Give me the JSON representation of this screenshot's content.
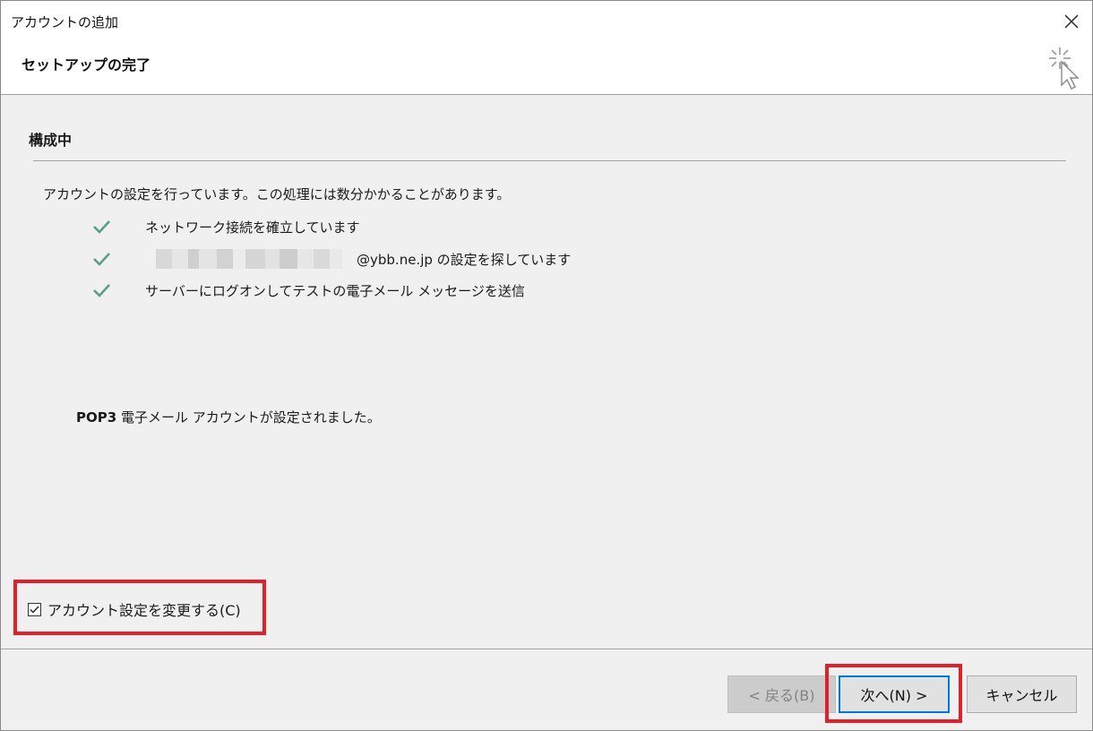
{
  "window": {
    "title": "アカウントの追加",
    "subtitle": "セットアップの完了",
    "close_icon": "close-icon",
    "wizard_icon": "sparkle-cursor-icon"
  },
  "content": {
    "section_title": "構成中",
    "description": "アカウントの設定を行っています。この処理には数分かかることがあります。",
    "steps": [
      {
        "icon": "check-icon",
        "text": "ネットワーク接続を確立しています"
      },
      {
        "icon": "check-icon",
        "text_suffix": "@ybb.ne.jp の設定を探しています"
      },
      {
        "icon": "check-icon",
        "text": "サーバーにログオンしてテストの電子メール メッセージを送信"
      }
    ],
    "result_bold": "POP3",
    "result_text": " 電子メール アカウントが設定されました。"
  },
  "options": {
    "change_settings_label": "アカウント設定を変更する(C)",
    "change_settings_checked": true
  },
  "buttons": {
    "back": "< 戻る(B)",
    "next": "次へ(N) >",
    "cancel": "キャンセル"
  },
  "colors": {
    "check": "#5a9e87",
    "highlight": "#e0202a",
    "focus": "#0078d7"
  }
}
